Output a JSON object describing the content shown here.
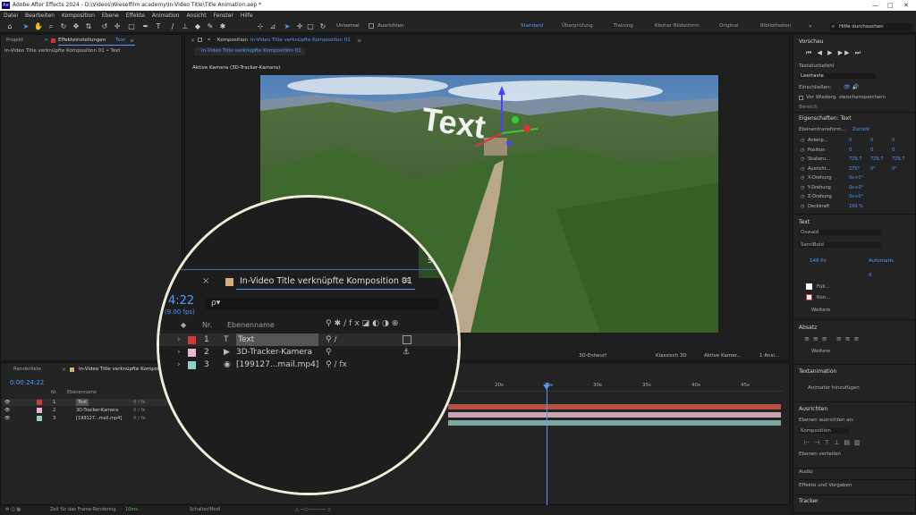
{
  "window": {
    "title": "Adobe After Effects 2024 - D:\\Videos\\Wieselfilm academy\\In-Video Title\\Title Animation.aep *",
    "app_icon": "Ae"
  },
  "menu": [
    "Datei",
    "Bearbeiten",
    "Komposition",
    "Ebene",
    "Effekte",
    "Animation",
    "Ansicht",
    "Fenster",
    "Hilfe"
  ],
  "toolbar": {
    "axis_mode": "Universal",
    "align_label": "Ausrichten",
    "workspaces": [
      "Standard",
      "Überprüfung",
      "Training",
      "Kleiner Bildschirm",
      "Original",
      "Bibliotheken"
    ],
    "active_workspace": "Standard",
    "search_placeholder": "Hilfe durchsuchen"
  },
  "left_panel": {
    "tab_project": "Projekt",
    "tab_effects": "Effekteinstellungen",
    "tab_effects_layer": "Text",
    "breadcrumb": "In-Video Title verknüpfte Komposition 01 • Text"
  },
  "composition": {
    "tab_label": "Komposition",
    "comp_name": "In-Video Title verknüpfte Komposition 01",
    "sub_tab": "In-Video Title verknüpfte Komposition 01",
    "camera_label": "Aktive Kamera (3D-Tracker-Kamera)",
    "overlay_text": "Text",
    "bottom": {
      "draft": "3D-Entwurf",
      "renderer": "Klassisch 3D",
      "camera": "Aktive Kamer...",
      "views": "1 Ansi..."
    }
  },
  "timeline": {
    "tab_render": "Renderliste",
    "tab_comp": "In-Video Title verknüpfte Komposition 01",
    "timecode": "0:00:24:22",
    "col_nr": "Nr.",
    "col_name": "Ebenenname",
    "layers": [
      {
        "nr": "1",
        "name": "Text",
        "color": "#d23a3a",
        "icon": "T"
      },
      {
        "nr": "2",
        "name": "3D-Tracker-Kamera",
        "color": "#e8b8c8",
        "icon": "cam"
      },
      {
        "nr": "3",
        "name": "[199127...mail.mp4]",
        "color": "#8fd0c8",
        "icon": "vid"
      }
    ],
    "ruler": [
      "20s",
      "25s",
      "30s",
      "35s",
      "40s",
      "45s"
    ],
    "status_render": "Zeit für das Frame-Rendering",
    "status_ms": "10ms",
    "status_mode": "Schalter/Modi"
  },
  "magnifier": {
    "comp_name": "In-Video Title verknüpfte Komposition 01",
    "timecode": "4:22",
    "fps": "(9.00 fps)",
    "search_hint": "ρ▾",
    "col_nr": "Nr.",
    "col_name": "Ebenenname",
    "layers": [
      {
        "nr": "1",
        "name": "Text",
        "color": "#d23a3a"
      },
      {
        "nr": "2",
        "name": "3D-Tracker-Kamera",
        "color": "#e8b8c8"
      },
      {
        "nr": "3",
        "name": "[199127...mail.mp4]",
        "color": "#8fd0c8"
      }
    ],
    "partial_value": "50"
  },
  "right_panel": {
    "preview": "Vorschau",
    "shortcut_label": "Tastaturbefehl",
    "shortcut_value": "Leertaste",
    "include_label": "Einschließen:",
    "loop_label": "Vor Wiederg. zwischenspeichern",
    "range_label": "Bereich",
    "properties_title": "Eigenschaften: Text",
    "transform_label": "Ebenentransform...",
    "reset_label": "Zurück",
    "props": [
      {
        "name": "Ankerp...",
        "v1": "0",
        "v2": "0",
        "v3": "0"
      },
      {
        "name": "Position",
        "v1": "0",
        "v2": "0",
        "v3": "0"
      },
      {
        "name": "Skalieru...",
        "v1": "729,7",
        "v2": "729,7",
        "v3": "729,7"
      },
      {
        "name": "Ausricht...",
        "v1": "270°",
        "v2": "0°",
        "v3": "0°"
      },
      {
        "name": "X-Drehung",
        "v1": "0x+0°",
        "v2": "",
        "v3": ""
      },
      {
        "name": "Y-Drehung",
        "v1": "0x+0°",
        "v2": "",
        "v3": ""
      },
      {
        "name": "Z-Drehung",
        "v1": "0x+0°",
        "v2": "",
        "v3": ""
      },
      {
        "name": "Deckkraft",
        "v1": "100 %",
        "v2": "",
        "v3": ""
      }
    ],
    "text_section": "Text",
    "font": "Oswald",
    "font_style": "SemiBold",
    "font_size": "148 Px",
    "tracking": "Automatis",
    "leading": "0",
    "fill_label": "Füll...",
    "stroke_label": "Kon...",
    "more_label": "Weitere",
    "paragraph": "Absatz",
    "text_animation": "Textanimation",
    "add_animator": "Animator hinzufügen",
    "align_section": "Ausrichten",
    "align_to_label": "Ebenen ausrichten an:",
    "align_to_value": "Komposition",
    "distribute_label": "Ebenen verteilen",
    "audio": "Audio",
    "effects_presets": "Effekte und Vorgaben",
    "tracker": "Tracker"
  },
  "colors": {
    "accent": "#4d9bff",
    "panel_bg": "#232323",
    "magnifier_border": "#f0ecd8",
    "layer_text": "#d23a3a"
  }
}
